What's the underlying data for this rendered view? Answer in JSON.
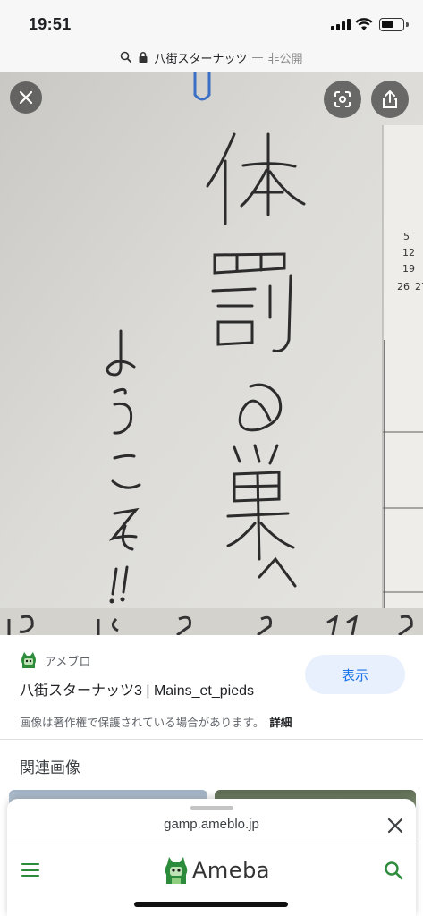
{
  "status_bar": {
    "time": "19:51"
  },
  "url_bar": {
    "site": "八街スターナッツ",
    "separator": "—",
    "status": "非公開"
  },
  "image_overlay": {
    "close_label": "close",
    "lens_label": "lens",
    "share_label": "share"
  },
  "result": {
    "source_name": "アメブロ",
    "title": "八街スターナッツ3 | Mains_et_pieds",
    "view_button": "表示",
    "notice": "画像は著作権で保護されている場合があります。",
    "notice_detail": "詳細"
  },
  "related": {
    "heading": "関連画像"
  },
  "sheet": {
    "domain": "gamp.ameblo.jp",
    "logo_text": "Ameba"
  },
  "colors": {
    "accent_blue": "#1a73e8",
    "button_bg": "#e8f0fe",
    "ameba_green": "#2d8c3c"
  }
}
